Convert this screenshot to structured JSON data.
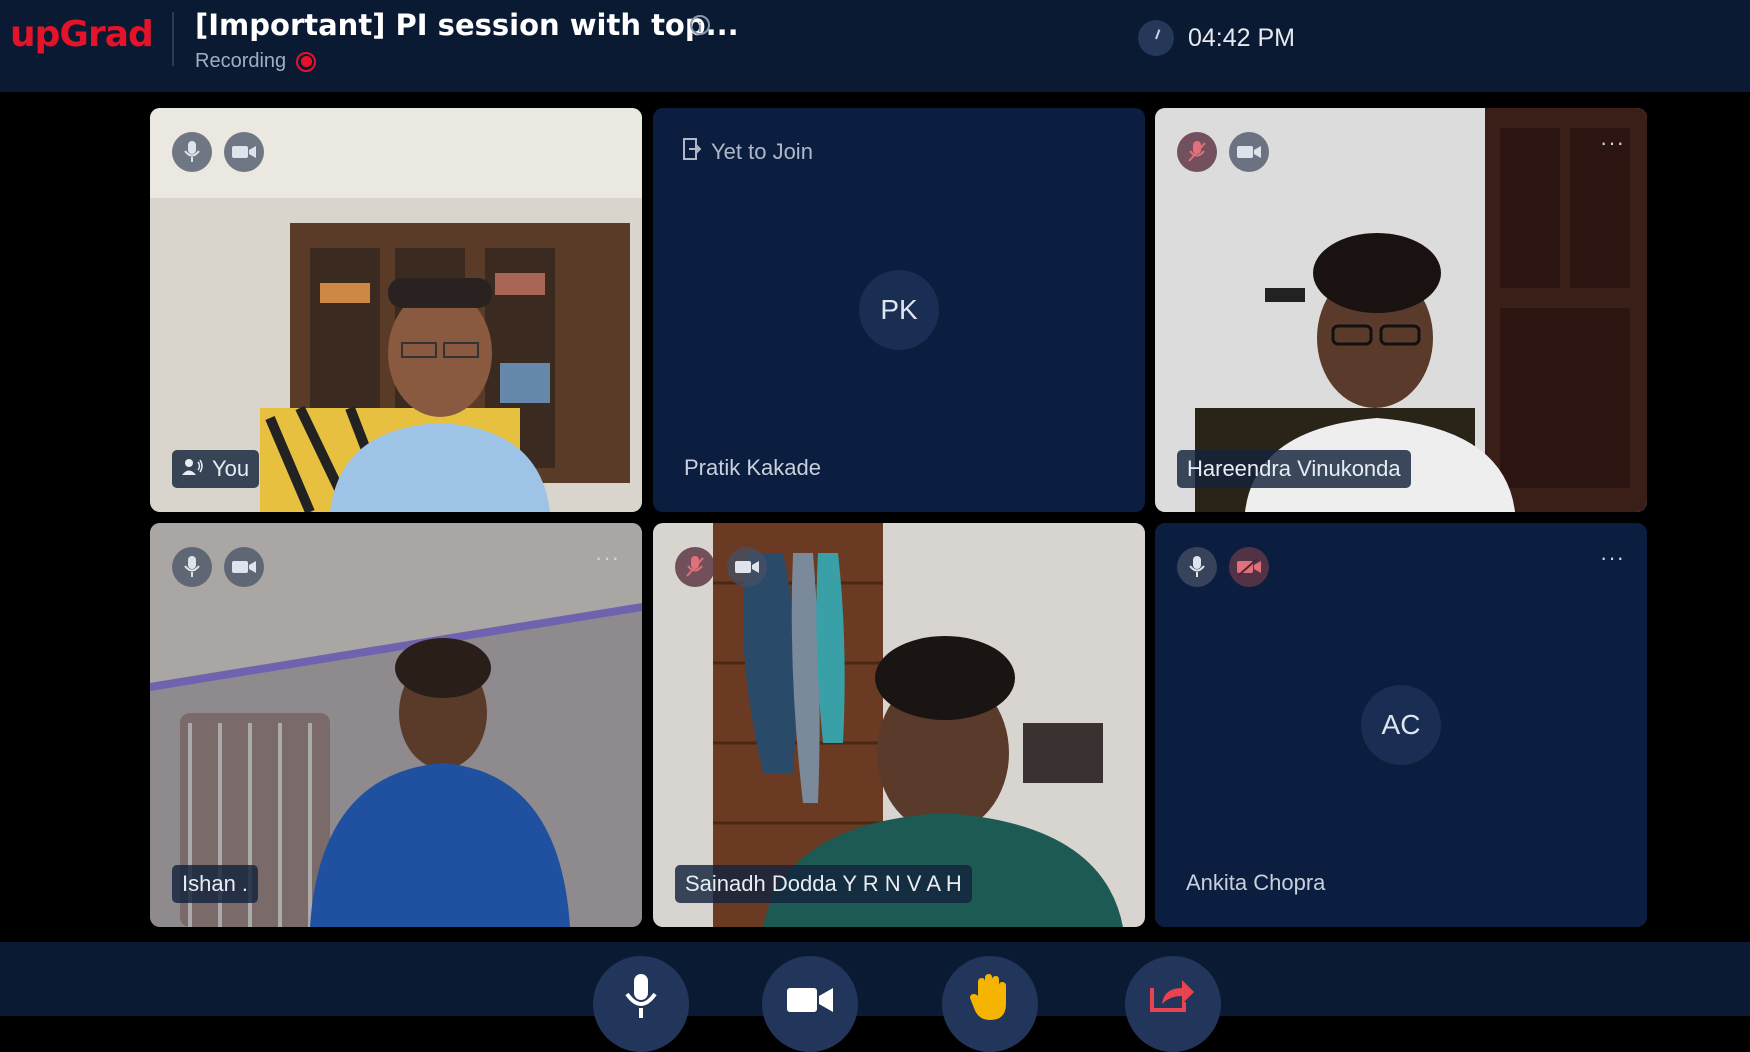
{
  "header": {
    "logo": "upGrad",
    "title": "[Important] PI session with top...",
    "info_icon": "i",
    "recording_label": "Recording",
    "time": "04:42 PM"
  },
  "participants": [
    {
      "name": "You",
      "mic": "on",
      "camera": "on",
      "video": true
    },
    {
      "name": "Pratik Kakade",
      "initials": "PK",
      "status": "Yet to Join",
      "video": false
    },
    {
      "name": "Hareendra Vinukonda",
      "mic": "muted",
      "camera": "on",
      "video": true,
      "menu": "···"
    },
    {
      "name": "Ishan .",
      "mic": "on",
      "camera": "on",
      "video": true,
      "menu": "···"
    },
    {
      "name": "Sainadh Dodda Y R N V A H",
      "mic": "muted",
      "camera": "on",
      "video": true,
      "menu": "···"
    },
    {
      "name": "Ankita Chopra",
      "initials": "AC",
      "mic": "on",
      "camera": "off",
      "video": false,
      "menu": "···"
    }
  ],
  "controls": [
    {
      "name": "microphone",
      "icon": "mic-icon"
    },
    {
      "name": "camera",
      "icon": "video-camera-icon"
    },
    {
      "name": "raise-hand",
      "icon": "hand-icon"
    },
    {
      "name": "share",
      "icon": "share-icon"
    }
  ],
  "colors": {
    "brand": "#e4132a",
    "bar_bg": "#0b1a33",
    "tile_bg": "#0b1e3f",
    "hand": "#f5b400"
  }
}
